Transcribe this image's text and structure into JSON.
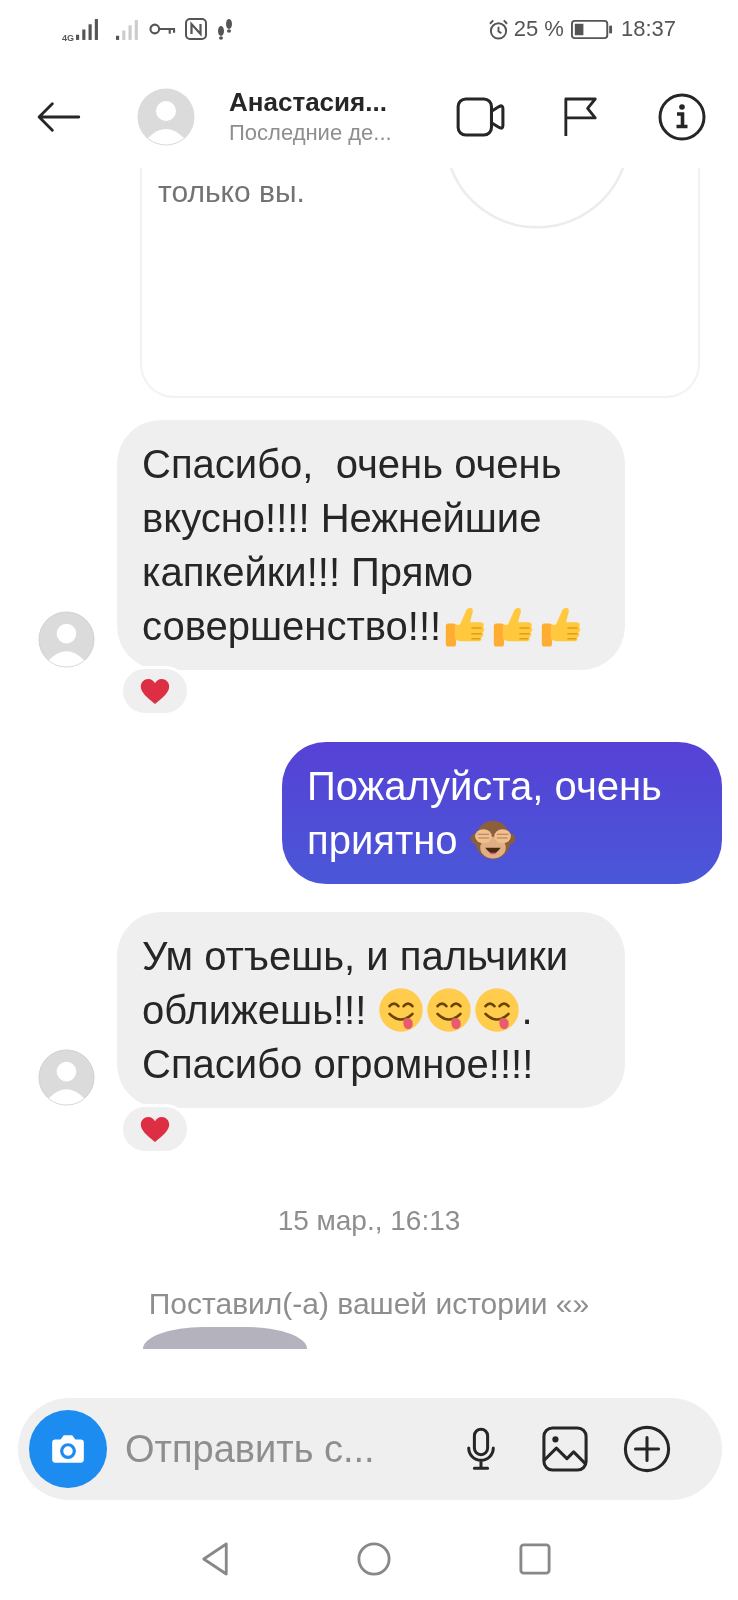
{
  "status_bar": {
    "network": "4G",
    "battery": "25 %",
    "time": "18:37"
  },
  "header": {
    "name": "Анастасия...",
    "status": "Последние де..."
  },
  "top_card": {
    "text": "только вы."
  },
  "messages": [
    {
      "kind": "incoming",
      "liked": true,
      "parts": [
        {
          "kind": "text",
          "text": "Спасибо,  очень очень вкусно!!!! Нежнейшие капкейки!!! Прямо совершенство!!!"
        },
        {
          "kind": "thumbsup"
        },
        {
          "kind": "thumbsup"
        },
        {
          "kind": "thumbsup"
        }
      ]
    },
    {
      "kind": "outgoing",
      "liked": false,
      "parts": [
        {
          "kind": "text",
          "text": "Пожалуйста, очень приятно "
        },
        {
          "kind": "monkey"
        }
      ]
    },
    {
      "kind": "incoming",
      "liked": true,
      "parts": [
        {
          "kind": "text",
          "text": "Ум отъешь, и пальчики оближешь!!! "
        },
        {
          "kind": "yum"
        },
        {
          "kind": "yum"
        },
        {
          "kind": "yum"
        },
        {
          "kind": "text",
          "text": ". Спасибо огромное!!!!"
        }
      ]
    }
  ],
  "timestamp": "15 мар., 16:13",
  "story_notice": "Поставил(-а) вашей истории «»",
  "composer": {
    "placeholder": "Отправить с..."
  }
}
